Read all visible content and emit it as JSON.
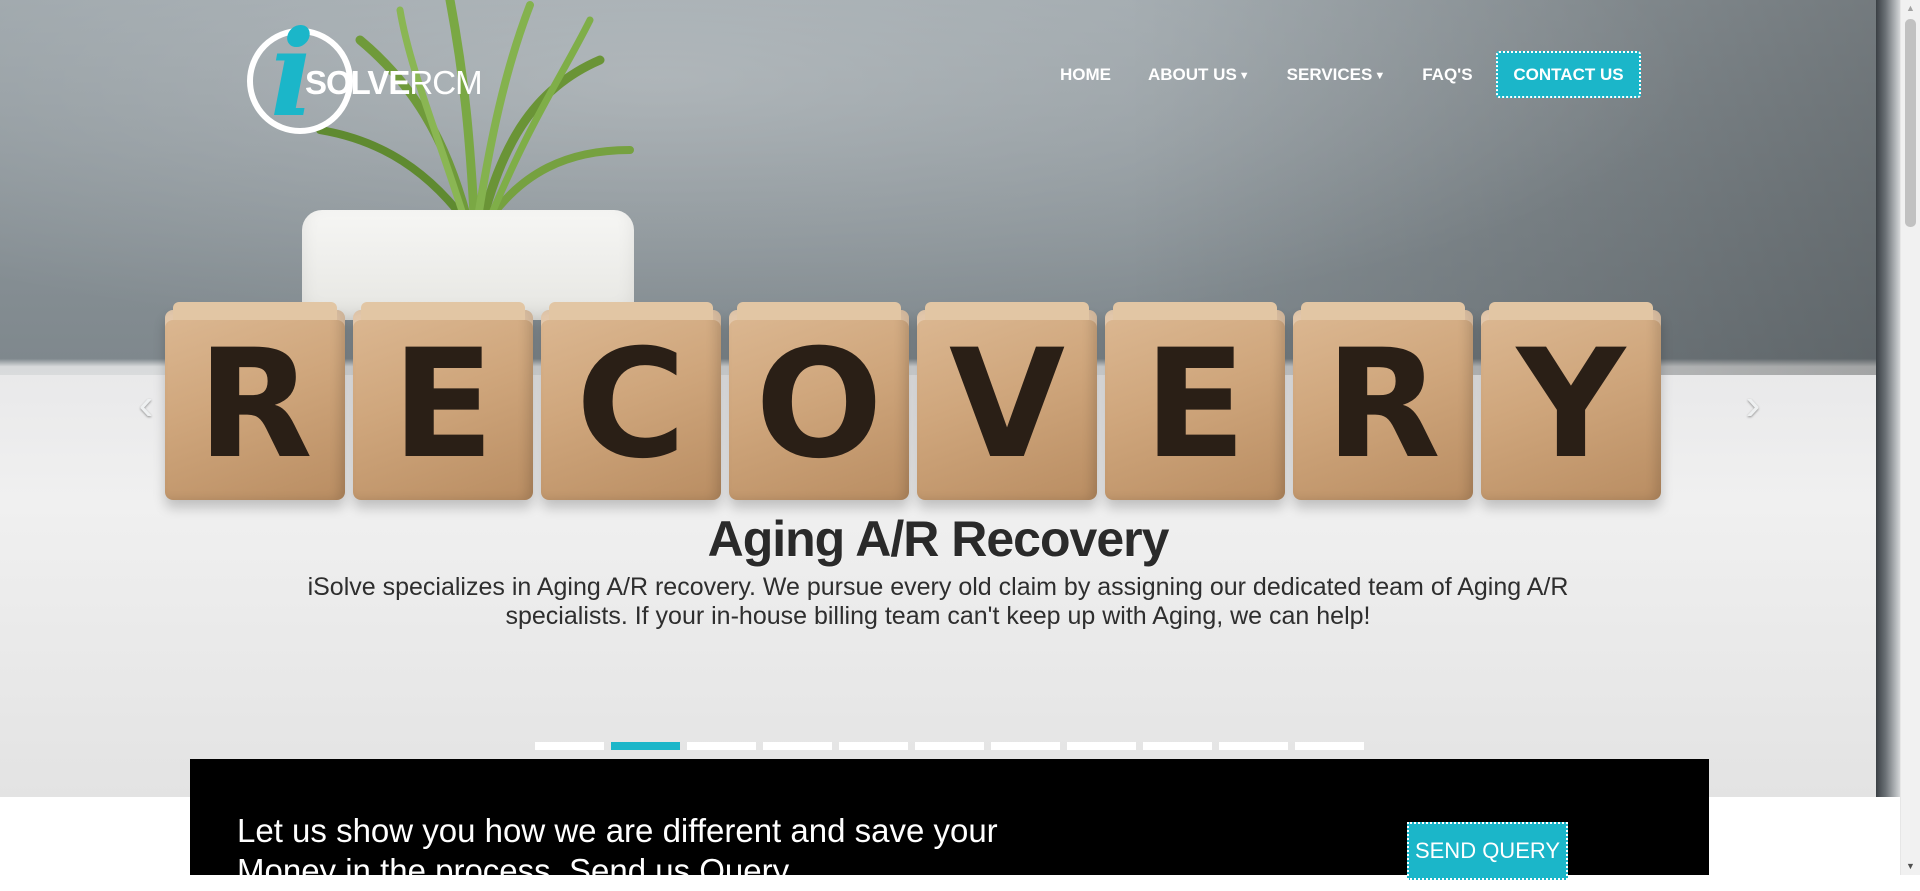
{
  "header": {
    "logo": {
      "letter": "i",
      "word_bold": "SOLVE",
      "word_light": "RCM"
    },
    "nav": [
      {
        "label": "HOME",
        "has_dropdown": false
      },
      {
        "label": "ABOUT US",
        "has_dropdown": true
      },
      {
        "label": "SERVICES",
        "has_dropdown": true
      },
      {
        "label": "FAQ'S",
        "has_dropdown": false
      }
    ],
    "contact_label": "CONTACT US"
  },
  "hero": {
    "block_letters": [
      "R",
      "E",
      "C",
      "O",
      "V",
      "E",
      "R",
      "Y"
    ],
    "slide_title": "Aging A/R Recovery",
    "slide_text": "iSolve specializes in Aging A/R recovery. We pursue every old claim by assigning our dedicated team of Aging A/R specialists. If your in-house billing team can't keep up with Aging, we can help!",
    "prev_icon": "chevron-left-icon",
    "next_icon": "chevron-right-icon",
    "prev_glyph": "‹",
    "next_glyph": "›",
    "indicator_count": 11,
    "active_indicator": 2
  },
  "cta": {
    "text": "Let us show you how we are different and save your Money in the process. Send us Query",
    "button_label": "SEND QUERY"
  },
  "colors": {
    "accent": "#1bb6c9",
    "cta_background": "#000000",
    "nav_text": "#ffffff"
  }
}
